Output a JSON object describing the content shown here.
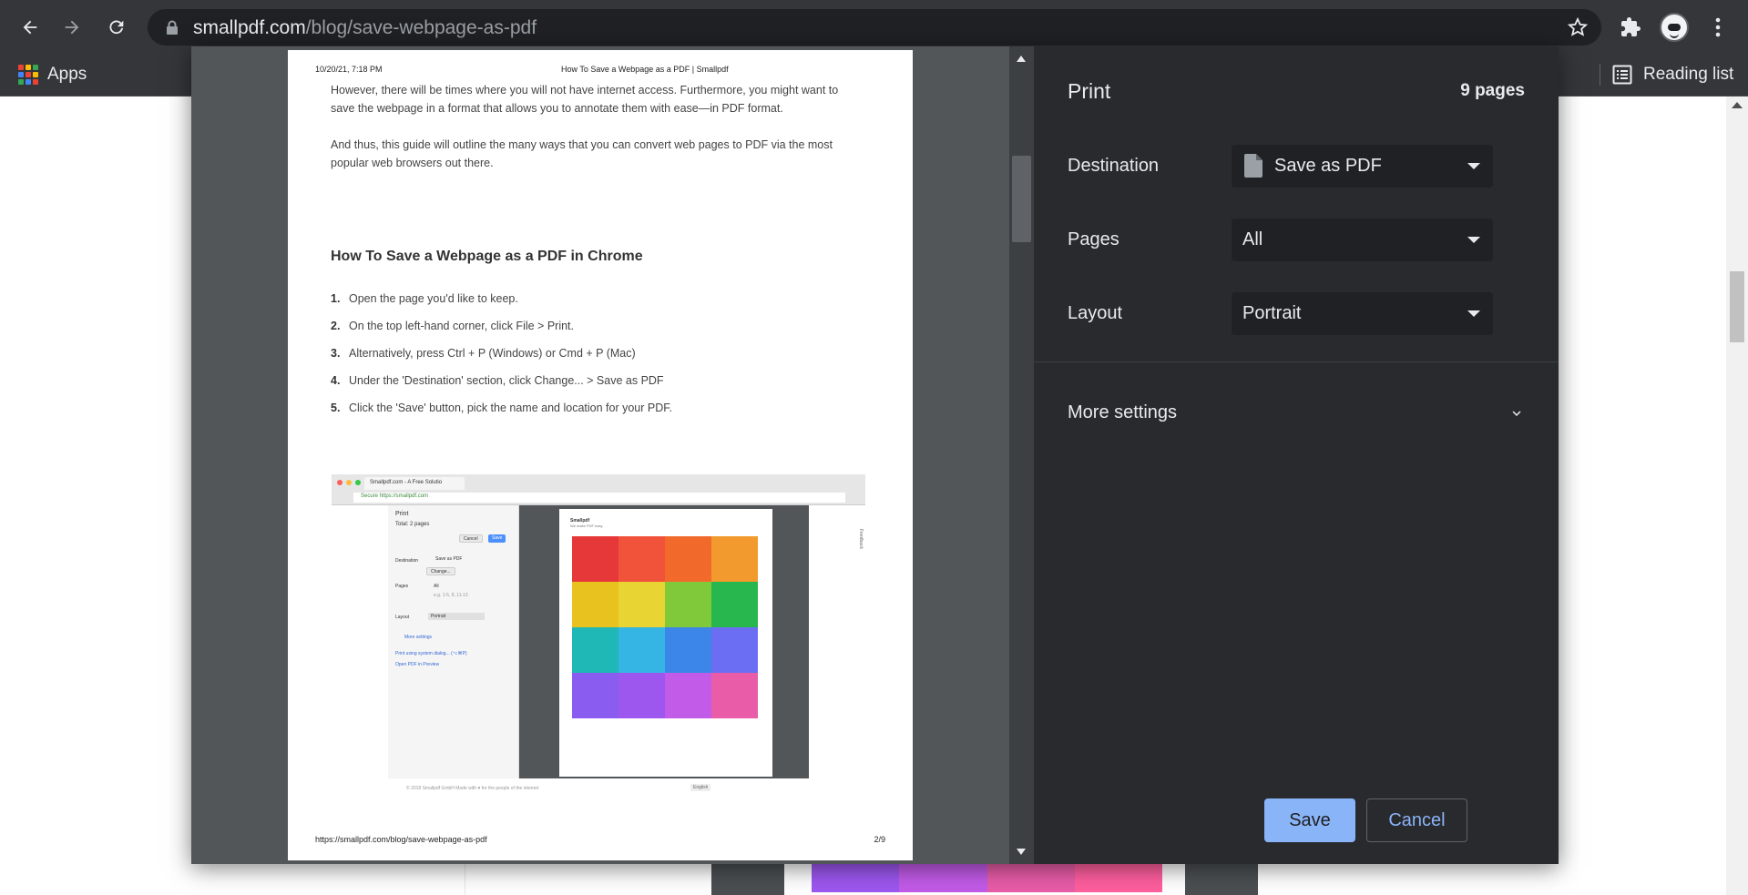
{
  "browser": {
    "url_host": "smallpdf.com",
    "url_path": "/blog/save-webpage-as-pdf",
    "bookmarks": {
      "apps_label": "Apps",
      "reading_list_label": "Reading list"
    },
    "apps_colors": [
      "#ea4335",
      "#fbbc05",
      "#34a853",
      "#4285f4",
      "#ea4335",
      "#fbbc05",
      "#34a853",
      "#4285f4",
      "#ea4335"
    ]
  },
  "preview": {
    "header_date": "10/20/21, 7:18 PM",
    "header_title": "How To Save a Webpage as a PDF | Smallpdf",
    "para1": "However, there will be times where you will not have internet access. Furthermore, you might want to save the webpage in a format that allows you to annotate them with ease—in PDF format.",
    "para2": "And thus, this guide will outline the many ways that you can convert web pages to PDF via the most popular web browsers out there.",
    "heading": "How To Save a Webpage as a PDF in Chrome",
    "steps": [
      {
        "n": "1.",
        "text": "Open the page you'd like to keep."
      },
      {
        "n": "2.",
        "text": "On the top left-hand corner, click File > Print."
      },
      {
        "n": "3.",
        "text": "Alternatively, press Ctrl + P (Windows) or Cmd + P (Mac)"
      },
      {
        "n": "4.",
        "text": "Under the 'Destination' section, click Change... > Save as PDF"
      },
      {
        "n": "5.",
        "text": "Click the 'Save' button, pick the name and location for your PDF."
      }
    ],
    "footer_url": "https://smallpdf.com/blog/save-webpage-as-pdf",
    "footer_page": "2/9",
    "embedded": {
      "tab": "Smallpdf.com - A Free Solutio",
      "address": "Secure  https://smallpdf.com",
      "print": "Print",
      "total": "Total: 2 pages",
      "cancel": "Cancel",
      "save": "Save",
      "destination": "Destination",
      "save_as_pdf": "Save as PDF",
      "change": "Change...",
      "pages": "Pages",
      "all": "All",
      "pages_placeholder": "e.g. 1-5, 8, 11-13",
      "layout": "Layout",
      "portrait": "Portrait",
      "more_settings": "More settings",
      "system_dialog": "Print using system dialog... (⌥⌘P)",
      "open_preview": "Open PDF in Preview",
      "brand": "Smallpdf",
      "tagline": "We make PDF easy.",
      "copyright": "© 2018 Smallpdf GmbH    Made with ♥ for the people of the internet",
      "language": "English",
      "feedback": "Feedback",
      "tile_colors": [
        "#e63838",
        "#f0523a",
        "#f26a2b",
        "#f39a2e",
        "#e8c21f",
        "#e8d432",
        "#7fc93a",
        "#28b74e",
        "#1fb8b6",
        "#35b5e4",
        "#3b86e8",
        "#6b6ef2",
        "#8a5cf0",
        "#9d57ef",
        "#c25be8",
        "#e85ca8"
      ]
    }
  },
  "settings": {
    "title": "Print",
    "page_count": "9 pages",
    "destination_label": "Destination",
    "destination_value": "Save as PDF",
    "pages_label": "Pages",
    "pages_value": "All",
    "layout_label": "Layout",
    "layout_value": "Portrait",
    "more_settings_label": "More settings",
    "save_label": "Save",
    "cancel_label": "Cancel"
  },
  "colors": {
    "accent": "#8ab4f8",
    "panel": "#292a2d",
    "select_bg": "#202124",
    "preview_bg": "#525659"
  },
  "bottom_tiles": [
    "#9d57ef",
    "#c25be8",
    "#e85ca8",
    "#ff5f9e"
  ]
}
